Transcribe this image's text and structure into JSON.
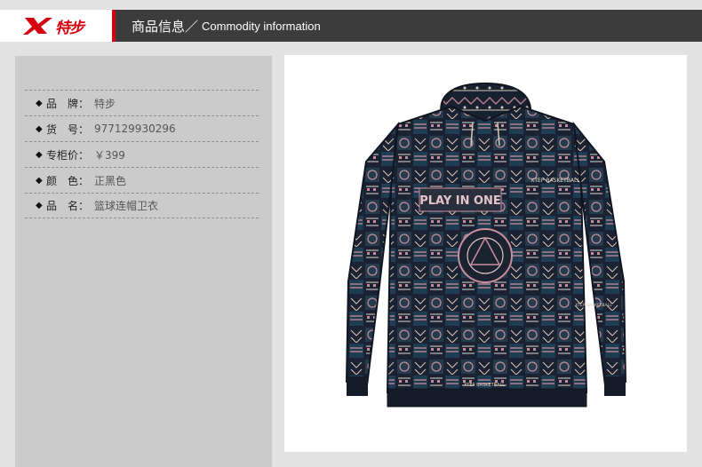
{
  "header": {
    "brand": "特步",
    "title_cn": "商品信息／",
    "title_en": "Commodity information"
  },
  "info": {
    "rows": [
      {
        "label": "品　牌：",
        "value": "特步"
      },
      {
        "label": "货　号：",
        "value": "977129930296"
      },
      {
        "label": "专柜价：",
        "value": "￥399"
      },
      {
        "label": "颜　色：",
        "value": "正黑色"
      },
      {
        "label": "品　名：",
        "value": "篮球连帽卫衣"
      }
    ]
  },
  "product_print": {
    "text_chest": "PLAY IN ONE",
    "text_tag": "XTEP BASKETBALL",
    "text_side": "XTEP BASKETBALL",
    "text_side_small": "XTEP BASKETBALL"
  },
  "colors": {
    "brand_red": "#d7000f",
    "header_dark": "#3c3c3c",
    "panel_gray": "#cbcbcb"
  }
}
